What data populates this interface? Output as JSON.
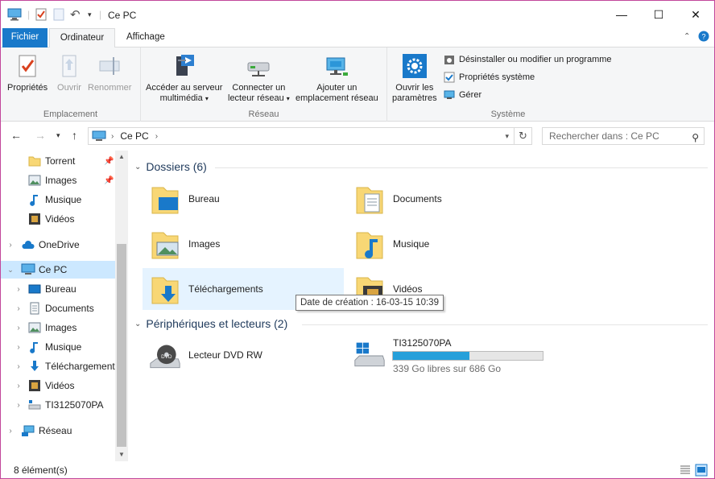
{
  "title": "Ce PC",
  "window_controls": {
    "minimize": "—",
    "maximize": "☐",
    "close": "✕"
  },
  "tabs": {
    "file": "Fichier",
    "computer": "Ordinateur",
    "view": "Affichage"
  },
  "ribbon": {
    "emplacement": {
      "label": "Emplacement",
      "properties": "Propriétés",
      "open": "Ouvrir",
      "rename": "Renommer"
    },
    "reseau": {
      "label": "Réseau",
      "media_line1": "Accéder au serveur",
      "media_line2": "multimédia",
      "map_line1": "Connecter un",
      "map_line2": "lecteur réseau",
      "add_line1": "Ajouter un",
      "add_line2": "emplacement réseau"
    },
    "systeme": {
      "label": "Système",
      "settings_line1": "Ouvrir les",
      "settings_line2": "paramètres",
      "uninstall": "Désinstaller ou modifier un programme",
      "sys_props": "Propriétés système",
      "manage": "Gérer"
    }
  },
  "address": {
    "path": "Ce PC",
    "search_placeholder": "Rechercher dans : Ce PC"
  },
  "nav": {
    "quick": [
      {
        "label": "Torrent",
        "pinned": true
      },
      {
        "label": "Images",
        "pinned": true
      },
      {
        "label": "Musique",
        "pinned": false
      },
      {
        "label": "Vidéos",
        "pinned": false
      }
    ],
    "onedrive": "OneDrive",
    "this_pc": "Ce PC",
    "pc_children": [
      "Bureau",
      "Documents",
      "Images",
      "Musique",
      "Téléchargement",
      "Vidéos",
      "TI3125070PA"
    ],
    "network": "Réseau"
  },
  "content": {
    "folders_header": "Dossiers (6)",
    "folders": [
      "Bureau",
      "Documents",
      "Images",
      "Musique",
      "Téléchargements",
      "Vidéos"
    ],
    "devices_header": "Périphériques et lecteurs (2)",
    "dvd": "Lecteur DVD RW",
    "drive_name": "TI3125070PA",
    "drive_free": "339 Go libres sur 686 Go",
    "drive_used_fraction": 0.51,
    "tooltip": "Date de création : 16-03-15 10:39"
  },
  "status": {
    "items": "8 élément(s)"
  },
  "colors": {
    "accent": "#1979ca",
    "selection": "#cce8ff",
    "bar": "#26a0da",
    "folder": "#f8d775"
  }
}
